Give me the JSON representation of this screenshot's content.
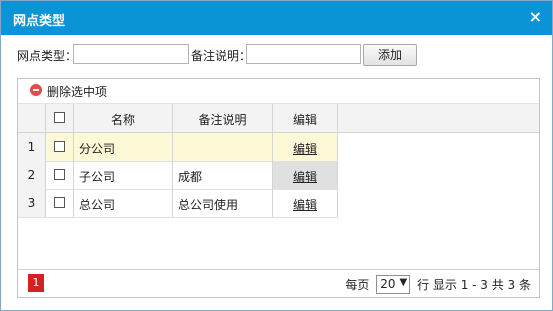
{
  "dialog": {
    "title": "网点类型",
    "close": "×"
  },
  "form": {
    "name_label": "网点类型：",
    "name_value": "",
    "remark_label": "备注说明：",
    "remark_value": "",
    "add_label": "添加"
  },
  "toolbar": {
    "delete_label": "删除选中项"
  },
  "grid": {
    "columns": {
      "name": "名称",
      "remark": "备注说明",
      "edit": "编辑"
    },
    "rows": [
      {
        "num": "1",
        "name": "分公司",
        "remark": "",
        "edit": "编辑",
        "selected": true
      },
      {
        "num": "2",
        "name": "子公司",
        "remark": "成都",
        "edit": "编辑",
        "selected": false
      },
      {
        "num": "3",
        "name": "总公司",
        "remark": "总公司使用",
        "edit": "编辑",
        "selected": false
      }
    ]
  },
  "pager": {
    "current_page": "1",
    "per_page_label": "每页",
    "page_size": "20",
    "summary": "行 显示 1 - 3 共 3 条"
  },
  "colors": {
    "title_bar": "#0a93d6",
    "selected_row": "#fdf8d6",
    "page_active": "#d42020"
  },
  "icons": {
    "close": "close-icon",
    "delete": "delete-icon",
    "dropdown": "chevron-down-icon"
  }
}
